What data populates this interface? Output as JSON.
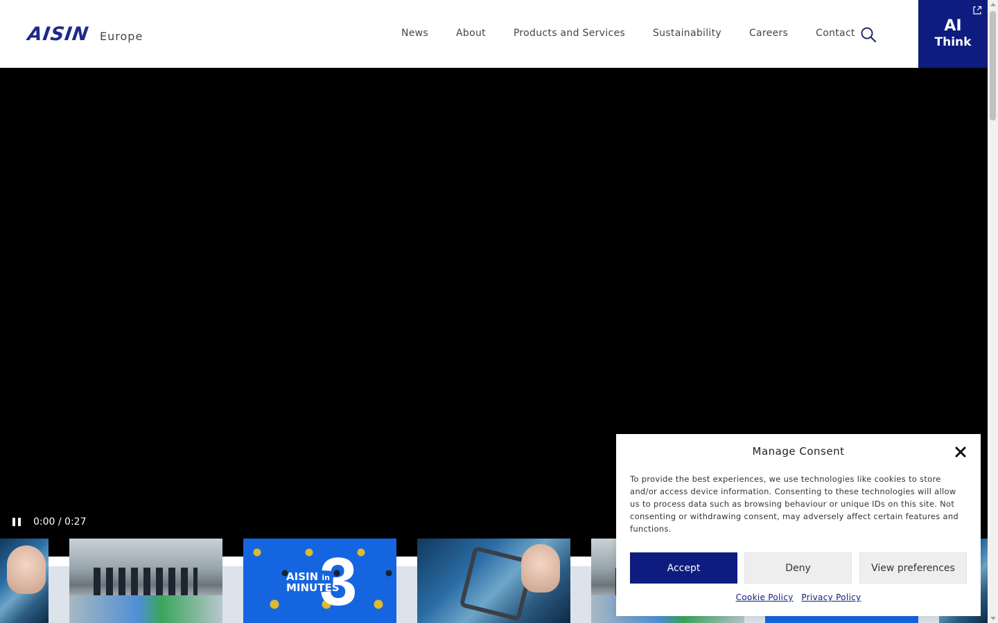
{
  "header": {
    "logo_mark": "AISIN",
    "logo_region": "Europe",
    "nav": [
      {
        "label": "News"
      },
      {
        "label": "About"
      },
      {
        "label": "Products and Services"
      },
      {
        "label": "Sustainability"
      },
      {
        "label": "Careers"
      },
      {
        "label": "Contact"
      }
    ],
    "search_icon": "search-icon",
    "ai_think": {
      "line1": "AI",
      "line2": "Think",
      "icon": "external-link-icon"
    }
  },
  "video": {
    "time": "0:00 / 0:27",
    "state": "playing",
    "pause_icon": "pause-icon"
  },
  "thumbnails": {
    "minutes_card": {
      "brand": "AISIN",
      "in": "in",
      "minutes": "MINUTES",
      "number": "3"
    }
  },
  "consent": {
    "title": "Manage Consent",
    "close_icon": "close-icon",
    "text": "To provide the best experiences, we use technologies like cookies to store and/or access device information. Consenting to these technologies will allow us to process data such as browsing behaviour or unique IDs on this site. Not consenting or withdrawing consent, may adversely affect certain features and functions.",
    "accept": "Accept",
    "deny": "Deny",
    "preferences": "View preferences",
    "cookie_policy": "Cookie Policy",
    "privacy_policy": "Privacy Policy"
  },
  "colors": {
    "brand_navy": "#0d1c7e",
    "minutes_blue": "#1565e0"
  }
}
